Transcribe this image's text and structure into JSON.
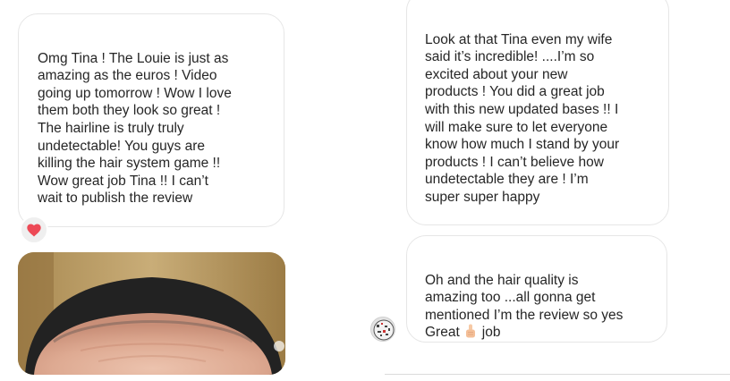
{
  "messages": {
    "left": {
      "text": "Omg Tina ! The Louie is just as\namazing as the euros ! Video\ngoing up tomorrow ! Wow I love\nthem both they look so great !\nThe hairline is truly truly\nundetectable! You guys are\nkilling the hair system game !!\nWow great job Tina !! I can’t\nwait to publish the review",
      "reaction_icon": "heart-icon",
      "reaction_color": "#ed4956"
    },
    "right_first": {
      "text": "Look at that Tina even my wife\nsaid it’s incredible! ....I’m so\nexcited about your new\nproducts ! You did a great job\nwith this new updated bases !! I\nwill make sure to let everyone\nknow how much I stand by your\nproducts ! I can’t believe how\nundetectable they are ! I’m\nsuper super happy"
    },
    "right_second": {
      "text_before": "Oh and the hair quality is\namazing too ...all gonna get\nmentioned I’m the review so yes\nGreat",
      "emoji_icon": "thumbs-up-icon",
      "text_after": "job"
    }
  },
  "colors": {
    "bubble_border": "#e6e6e6",
    "text": "#262626",
    "heart": "#ed4956"
  }
}
